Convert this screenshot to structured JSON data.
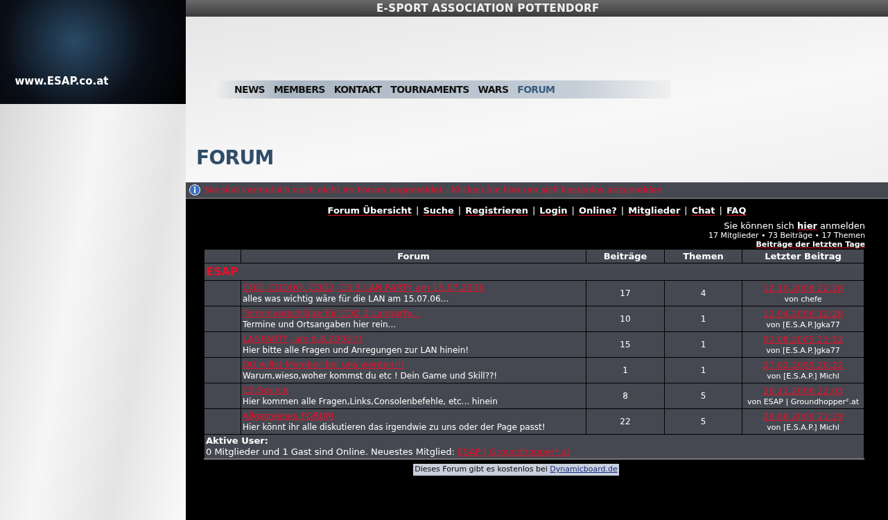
{
  "logo": {
    "text": "www.ESAP.co.at"
  },
  "header": {
    "title": "E-SPORT ASSOCIATION POTTENDORF"
  },
  "nav": [
    {
      "label": "NEWS",
      "selected": false
    },
    {
      "label": "MEMBERS",
      "selected": false
    },
    {
      "label": "KONTAKT",
      "selected": false
    },
    {
      "label": "TOURNAMENTS",
      "selected": false
    },
    {
      "label": "WARS",
      "selected": false
    },
    {
      "label": "FORUM",
      "selected": true
    }
  ],
  "page_title": "FORUM",
  "notice": "Sie sind vermutlich noch nicht im Forum angemeldet - Klicken Sie hier um sich kostenlos anzumelden",
  "forum_menu": {
    "separator": "|",
    "links": [
      "Forum Übersicht",
      "Suche",
      "Registrieren",
      "Login",
      "Online?",
      "Mitglieder",
      "Chat",
      "FAQ"
    ]
  },
  "login_hint": {
    "before": "Sie können sich ",
    "link": "hier",
    "after": " anmelden"
  },
  "stats": "17 Mitglieder • 73 Beiträge • 17 Themen",
  "recent_link": "Beiträge der letzten Tage",
  "table": {
    "columns": [
      "Forum",
      "Beiträge",
      "Themen",
      "Letzter Beitrag"
    ],
    "category": "ESAP",
    "rows": [
      {
        "title": "COD, CODUO, COD2, CS:S LAN PARTY am 15.07.2006",
        "description": "alles was wichtig wäre für die LAN am 15.07.06...",
        "posts": "17",
        "topics": "4",
        "last_date": "12.10.2006 22:28",
        "last_by": "von chefe"
      },
      {
        "title": "Terminvorschläge für COD 2 Lanparty...",
        "description": "Termine und Ortsangaben hier rein...",
        "posts": "10",
        "topics": "1",
        "last_date": "12.04.2006 12:28",
        "last_by": "von [E.S.A.P.]gka77"
      },
      {
        "title": "LANPARTY, am 6.8.2005!!!",
        "description": "Hier bitte alle Fragen und Anregungen zur LAN hinein!",
        "posts": "15",
        "topics": "1",
        "last_date": "02.08.2005 23:52",
        "last_by": "von [E.S.A.P.]gka77"
      },
      {
        "title": "DU willst Member bei uns werden!!!",
        "description": "Warum,wieso,woher kommst du etc ! Dein Game und Skill??!",
        "posts": "1",
        "topics": "1",
        "last_date": "27.02.2005 20:22",
        "last_by": "von [E.S.A.P.] Michl"
      },
      {
        "title": "CS:Source",
        "description": "Hier kommen alle Fragen,Links,Consolenbefehle, etc... hinein",
        "posts": "8",
        "topics": "5",
        "last_date": "26.11.2006 22:03",
        "last_by": "von ESAP | Groundhopper².at"
      },
      {
        "title": "Allgemeines FORUM",
        "description": "Hier könnt ihr alle diskutieren das irgendwie zu uns oder der Page passt!",
        "posts": "22",
        "topics": "5",
        "last_date": "26.06.2006 21:29",
        "last_by": "von [E.S.A.P.] Michl"
      }
    ]
  },
  "active_users": {
    "heading": "Aktive User:",
    "text": "0 Mitglieder und 1 Gast sind Online. Neuestes Mitglied: ",
    "link": "ESAP | Groundhopper².at"
  },
  "footer": {
    "text": "Dieses Forum gibt es kostenlos bei ",
    "link": "Dynamicboard.de"
  }
}
